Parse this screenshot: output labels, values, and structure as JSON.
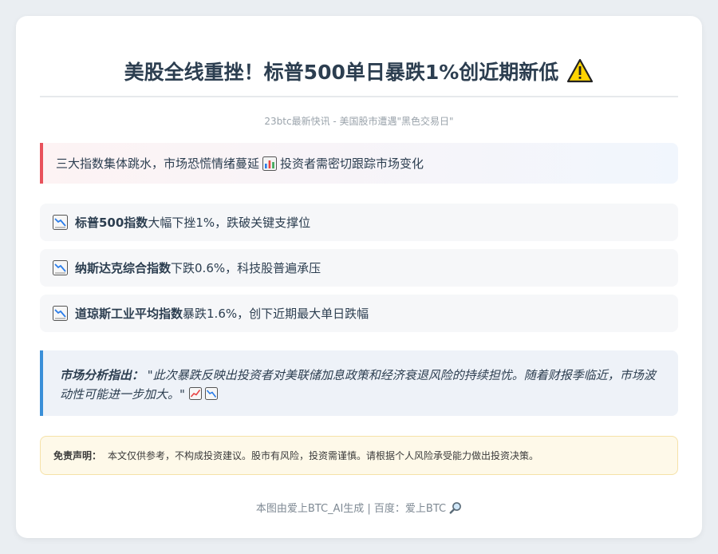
{
  "header": {
    "title": "美股全线重挫！标普500单日暴跌1%创近期新低",
    "title_icon": "warning-icon",
    "subtitle": "23btc最新快讯 - 美国股市遭遇\"黑色交易日\""
  },
  "alert": {
    "text_before": "三大指数集体跳水，市场恐慌情绪蔓延",
    "icon": "bar-chart-icon",
    "text_after": "投资者需密切跟踪市场变化",
    "accent": "#e8525c"
  },
  "items": [
    {
      "icon": "chart-down-icon",
      "bold": "标普500指数",
      "text": "大幅下挫1%，跌破关键支撑位"
    },
    {
      "icon": "chart-down-icon",
      "bold": "纳斯达克综合指数",
      "text": "下跌0.6%，科技股普遍承压"
    },
    {
      "icon": "chart-down-icon",
      "bold": "道琼斯工业平均指数",
      "text": "暴跌1.6%，创下近期最大单日跌幅"
    }
  ],
  "analysis": {
    "label": "市场分析指出：",
    "text": "\"此次暴跌反映出投资者对美联储加息政策和经济衰退风险的持续担忧。随着财报季临近，市场波动性可能进一步加大。\"",
    "accent": "#3a8fd8"
  },
  "disclaimer": {
    "label": "免责声明：",
    "text": "本文仅供参考，不构成投资建议。股市有风险，投资需谨慎。请根据个人风险承受能力做出投资决策。"
  },
  "footer": {
    "text": "本图由爱上BTC_AI生成 | 百度：爱上BTC",
    "icon": "magnifier-icon"
  }
}
